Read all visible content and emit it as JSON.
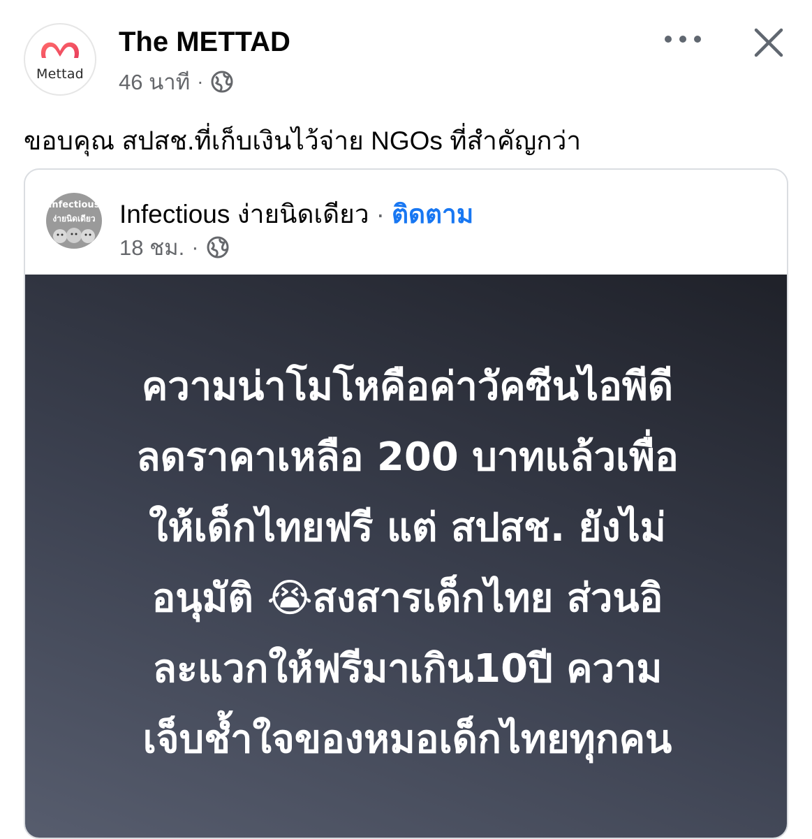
{
  "post": {
    "page_name": "The METTAD",
    "avatar_text": "Mettad",
    "time": "46 นาที",
    "separator": "·",
    "caption": "ขอบคุณ สปสช.ที่เก็บเงินไว้จ่าย NGOs ที่สำคัญกว่า"
  },
  "shared": {
    "avatar_line1": "Infectious",
    "avatar_line2": "ง่ายนิดเดียว",
    "page_name": "Infectious ง่ายนิดเดียว",
    "separator": "·",
    "follow_label": "ติดตาม",
    "time": "18 ชม.",
    "image_lines": [
      "ความน่าโมโหคือค่าวัคซีนไอพีดี",
      "ลดราคาเหลือ 200 บาทแล้วเพื่อ",
      "ให้เด็กไทยฟรี แต่ สปสช. ยังไม่",
      "อนุมัติ 😭สงสารเด็กไทย ส่วนอิ",
      "ละแวกให้ฟรีมาเกิน10ปี ความ",
      "เจ็บช้ำใจของหมอเด็กไทยทุกคน"
    ]
  },
  "icons": {
    "globe": "globe-icon",
    "more": "more-horizontal-icon",
    "close": "close-icon",
    "logo": "mettad-logo-icon"
  },
  "colors": {
    "link_blue": "#1877f2",
    "meta_gray": "#65676b",
    "logo_red": "#ef4b5c"
  }
}
